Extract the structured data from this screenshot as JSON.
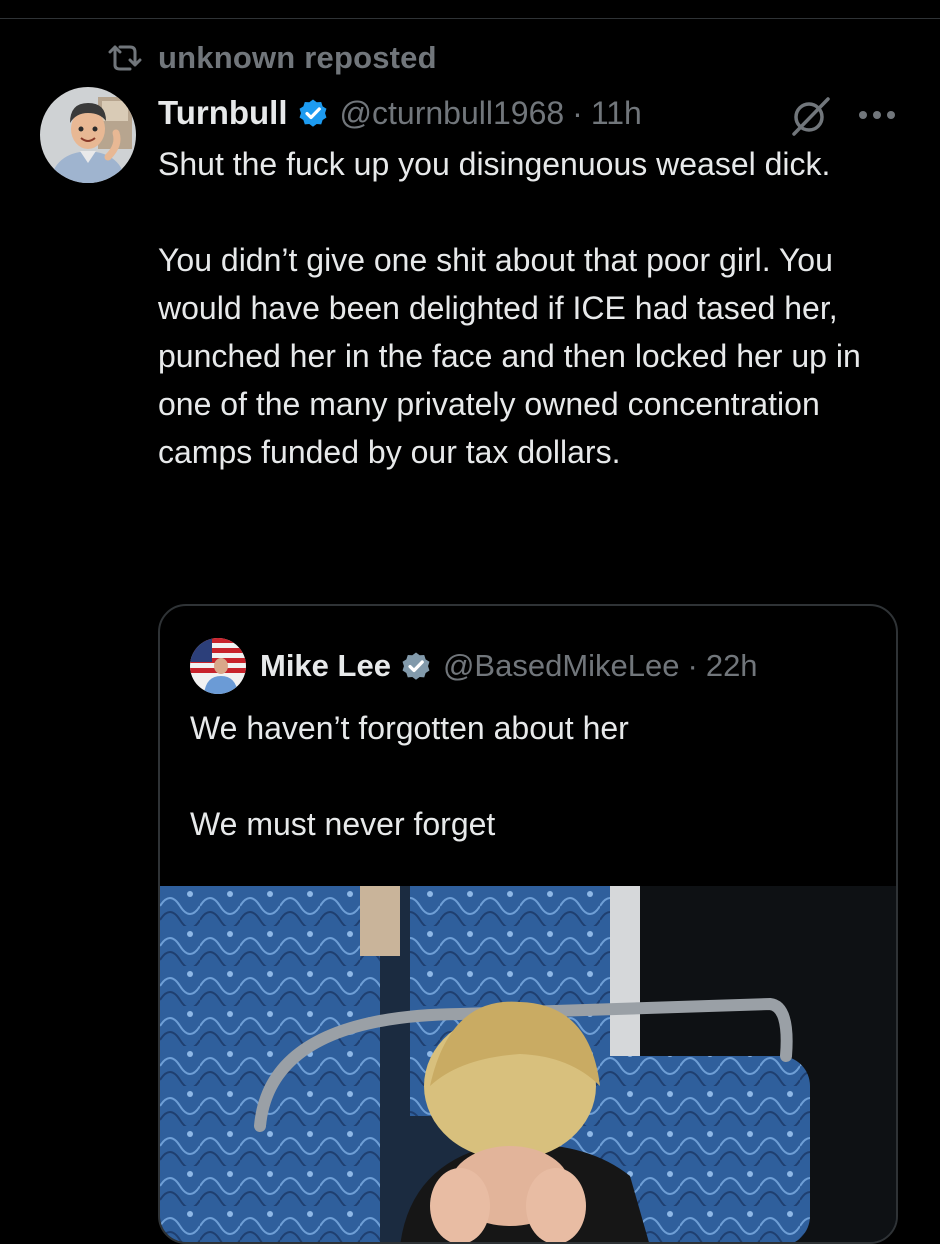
{
  "repost": {
    "label": "unknown reposted"
  },
  "tweet": {
    "display_name": "Turnbull",
    "handle": "@cturnbull1968",
    "separator": "·",
    "time": "11h",
    "text": "Shut the fuck up you disingenuous weasel dick.\n\nYou didn’t give one shit about that poor girl. You would have been delighted if ICE had tased her, punched her in the face and then locked her up in one of the many privately owned concentration camps funded by our tax dollars."
  },
  "quote": {
    "display_name": "Mike Lee",
    "handle": "@BasedMikeLee",
    "separator": "·",
    "time": "22h",
    "text": "We haven’t forgotten about her\n\nWe must never forget"
  },
  "icons": {
    "repost": "repost-icon",
    "verified": "verified-badge-icon",
    "grok": "grok-icon",
    "more": "more-icon"
  },
  "colors": {
    "background": "#000000",
    "text_primary": "#e7e9ea",
    "text_secondary": "#71767b",
    "verified_blue": "#1d9bf0",
    "verified_gray": "#829aab",
    "border": "#2f3336"
  }
}
